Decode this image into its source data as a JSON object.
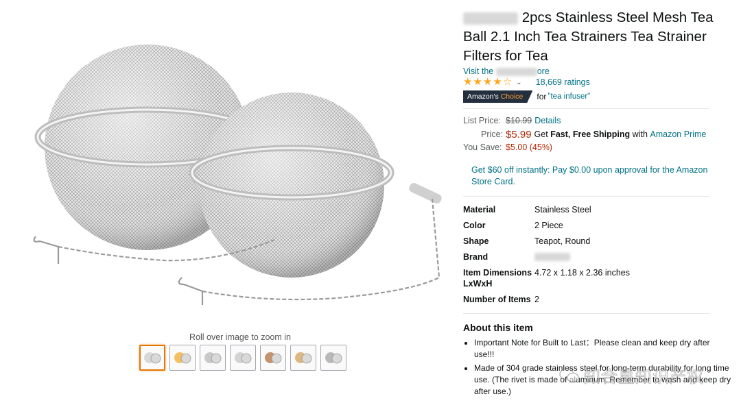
{
  "gallery": {
    "zoom_hint": "Roll over image to zoom in",
    "thumbnails": [
      "thumb-1",
      "thumb-2",
      "thumb-3",
      "thumb-4",
      "thumb-5",
      "thumb-6",
      "thumb-7"
    ]
  },
  "product": {
    "title": "2pcs Stainless Steel Mesh Tea Ball 2.1 Inch Tea Strainers Tea Strainer Filters for Tea",
    "store_prefix": "Visit the",
    "store_suffix": "ore",
    "rating": 4.0,
    "ratings_count": "18,669 ratings",
    "badge_prefix": "Amazon's",
    "badge_highlight": "Choice",
    "badge_for": "for",
    "badge_keyword": "\"tea infuser\""
  },
  "pricing": {
    "list_label": "List Price:",
    "list_price": "$10.99",
    "details_link": "Details",
    "price_label": "Price:",
    "price": "$5.99",
    "shipping_prefix": "Get",
    "shipping_bold": "Fast, Free Shipping",
    "shipping_with": "with",
    "prime_link": "Amazon Prime",
    "save_label": "You Save:",
    "save_value": "$5.00 (45%)",
    "card_offer": "Get $60 off instantly: Pay $0.00 upon approval for the Amazon Store Card."
  },
  "specs": [
    {
      "key": "Material",
      "value": "Stainless Steel"
    },
    {
      "key": "Color",
      "value": "2 Piece"
    },
    {
      "key": "Shape",
      "value": "Teapot, Round"
    },
    {
      "key": "Brand",
      "value": ""
    },
    {
      "key": "Item Dimensions LxWxH",
      "value": "4.72 x 1.18 x 2.36 inches"
    },
    {
      "key": "Number of Items",
      "value": "2"
    }
  ],
  "about": {
    "title": "About this item",
    "bullets": [
      "Important Note for Built to Last：Please clean and keep dry after use!!!",
      "Made of 304 grade stainless steel for long-term durability for long time use. (The rivet is made of aluminum. Remember to wash and keep dry after use.)"
    ]
  },
  "watermark": {
    "text": "知合星知识产权"
  },
  "colors": {
    "link": "#007185",
    "price": "#b12704",
    "badge_bg": "#232f3e",
    "badge_orange": "#f69931",
    "star": "#ffa41c"
  }
}
